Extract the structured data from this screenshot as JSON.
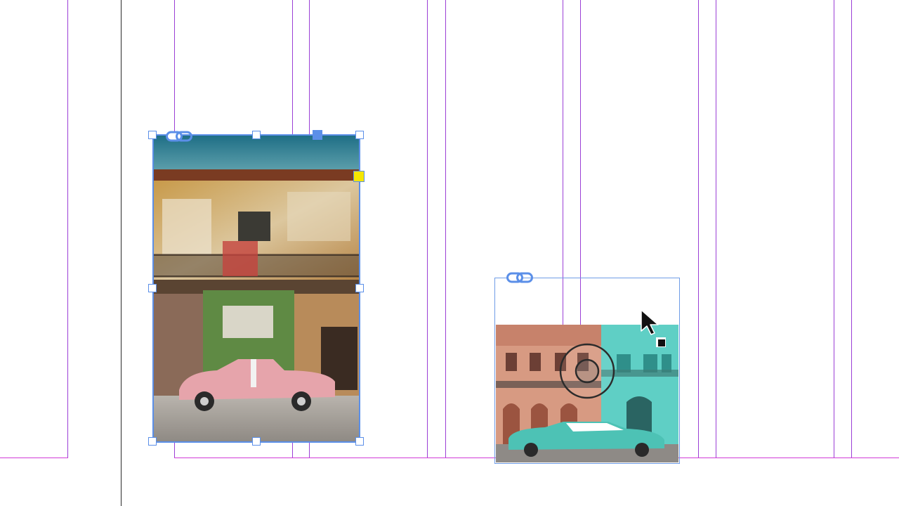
{
  "canvas": {
    "guide_color": "#9b3fd6",
    "margin_color": "#d23bd8",
    "selection_color": "#5b8fe8"
  },
  "frames": [
    {
      "name": "havana-building-photo",
      "state": "selected",
      "icons": [
        "link-icon"
      ],
      "handles": [
        "top-left",
        "top-center",
        "top-right",
        "middle-left",
        "middle-right",
        "bottom-left",
        "bottom-center",
        "bottom-right",
        "corner-radius",
        "in-port"
      ]
    },
    {
      "name": "havana-street-photo",
      "state": "outlined",
      "icons": [
        "link-icon",
        "content-grabber-icon",
        "pointer-cursor-icon"
      ]
    }
  ]
}
